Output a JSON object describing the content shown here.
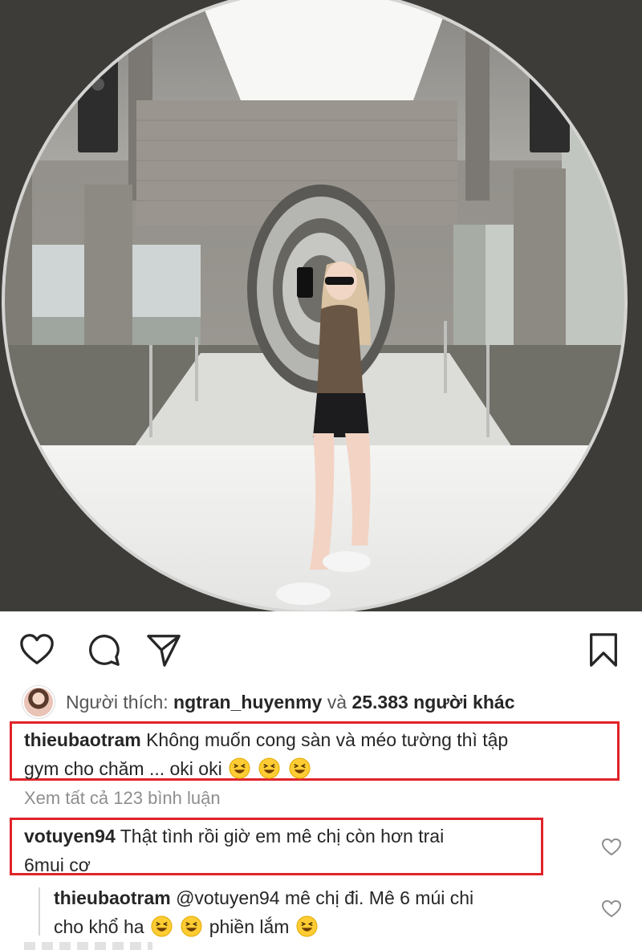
{
  "post": {
    "image_description_icon": "photo-mirror-selfie"
  },
  "actions": {
    "like_icon": "heart-outline-icon",
    "comment_icon": "comment-bubble-icon",
    "share_icon": "paper-plane-icon",
    "save_icon": "bookmark-icon"
  },
  "likes": {
    "prefix": "Người thích:",
    "user": "ngtran_huyenmy",
    "connector": "và",
    "count": "25.383 người khác"
  },
  "caption": {
    "user": "thieubaotram",
    "text_line1": "Không muốn cong sàn và méo tường thì tập",
    "text_line2": "gym cho chăm ... oki oki"
  },
  "view_all": "Xem tất cả 123 bình luận",
  "comments": [
    {
      "user": "votuyen94",
      "text_line1": "Thật tình rồi giờ em mê chị còn hơn trai",
      "text_line2": "6mui cơ"
    },
    {
      "user": "thieubaotram",
      "mention": "@votuyen94",
      "text_line1": "mê chị đi. Mê 6 múi chi",
      "text_line2_a": "cho khổ ha",
      "text_line2_b": "phiền lắm"
    }
  ],
  "colors": {
    "highlight_box": "#e0242a",
    "muted_text": "#8e8e8e",
    "text": "#262626"
  }
}
